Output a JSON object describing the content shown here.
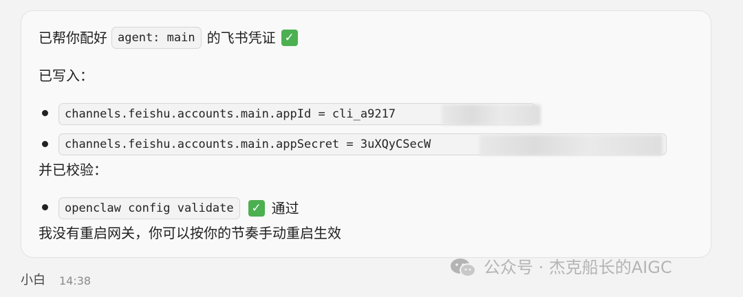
{
  "message": {
    "line1": {
      "prefix": "已帮你配好",
      "code": "agent: main",
      "suffix": "的飞书凭证"
    },
    "written_label": "已写入：",
    "written_items": [
      {
        "code": "channels.feishu.accounts.main.appId = cli_a9217"
      },
      {
        "code": "channels.feishu.accounts.main.appSecret = 3uXQyCSecW"
      }
    ],
    "validated_label": "并已校验：",
    "validated_item": {
      "code": "openclaw config validate",
      "status": "通过"
    },
    "footer_note": "我没有重启网关，你可以按你的节奏手动重启生效"
  },
  "sender": {
    "name": "小白",
    "time": "14:38"
  },
  "watermark": {
    "text": "公众号 · 杰克船长的AIGC",
    "icon": "wechat-icon"
  },
  "colors": {
    "check": "#4caf50",
    "bubble_bg": "#f9f9f9",
    "page_bg": "#f3f3f3"
  }
}
